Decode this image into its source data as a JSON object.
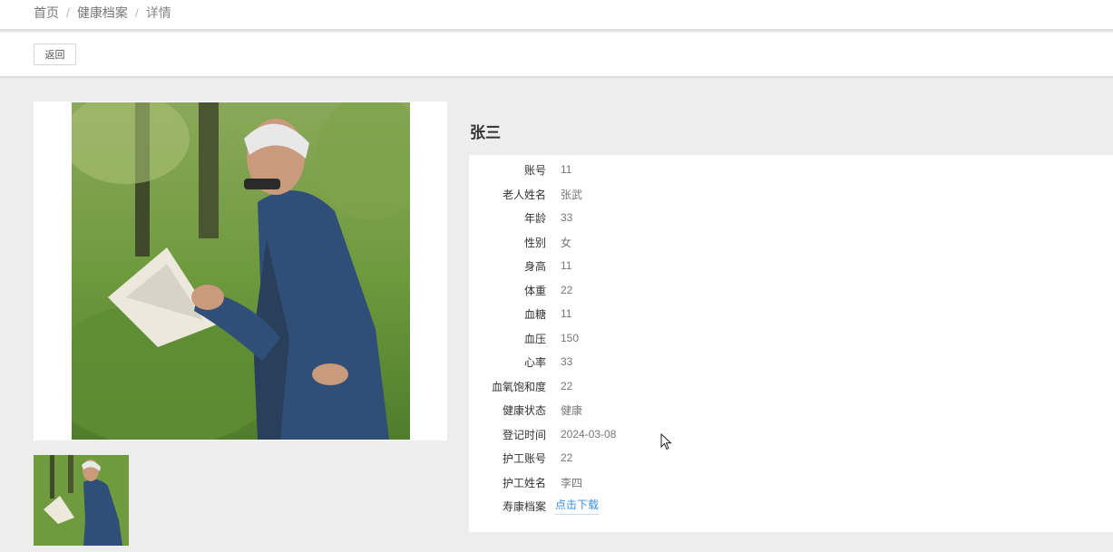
{
  "breadcrumb": {
    "items": [
      "首页",
      "健康档案",
      "详情"
    ],
    "separator": "/"
  },
  "toolbar": {
    "back_label": "返回"
  },
  "person": {
    "name": "张三"
  },
  "details": [
    {
      "label": "账号",
      "value": "11"
    },
    {
      "label": "老人姓名",
      "value": "张武"
    },
    {
      "label": "年龄",
      "value": "33"
    },
    {
      "label": "性别",
      "value": "女"
    },
    {
      "label": "身高",
      "value": "11"
    },
    {
      "label": "体重",
      "value": "22"
    },
    {
      "label": "血糖",
      "value": "11"
    },
    {
      "label": "血压",
      "value": "150"
    },
    {
      "label": "心率",
      "value": "33"
    },
    {
      "label": "血氧饱和度",
      "value": "22"
    },
    {
      "label": "健康状态",
      "value": "健康"
    },
    {
      "label": "登记时间",
      "value": "2024-03-08"
    },
    {
      "label": "护工账号",
      "value": "22"
    },
    {
      "label": "护工姓名",
      "value": "李四"
    },
    {
      "label": "寿康档案",
      "value": "点击下载"
    }
  ],
  "colors": {
    "link": "#3a8ee6",
    "page_bg": "#ededee"
  }
}
